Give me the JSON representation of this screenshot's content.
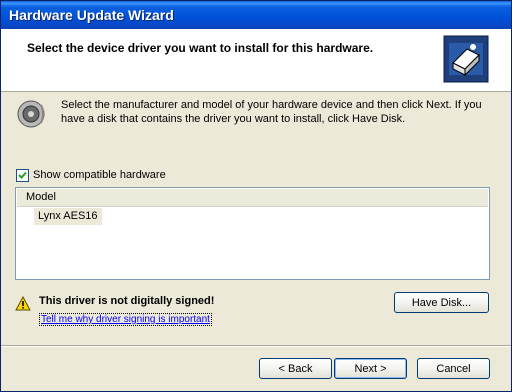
{
  "window": {
    "title": "Hardware Update Wizard"
  },
  "header": {
    "title": "Select the device driver you want to install for this hardware.",
    "icon": "hardware-wizard-icon"
  },
  "intro": {
    "text": "Select the manufacturer and model of your hardware device and then click Next. If you have a disk that contains the driver you want to install, click Have Disk.",
    "icon": "speaker-icon"
  },
  "compatible": {
    "label": "Show compatible hardware",
    "checked": true
  },
  "list": {
    "column_header": "Model",
    "items": [
      "Lynx AES16"
    ]
  },
  "warning": {
    "text": "This driver is not digitally signed!",
    "link": "Tell me why driver signing is important",
    "icon": "warning-icon"
  },
  "buttons": {
    "have_disk": "Have Disk...",
    "back": "< Back",
    "next": "Next >",
    "cancel": "Cancel"
  }
}
